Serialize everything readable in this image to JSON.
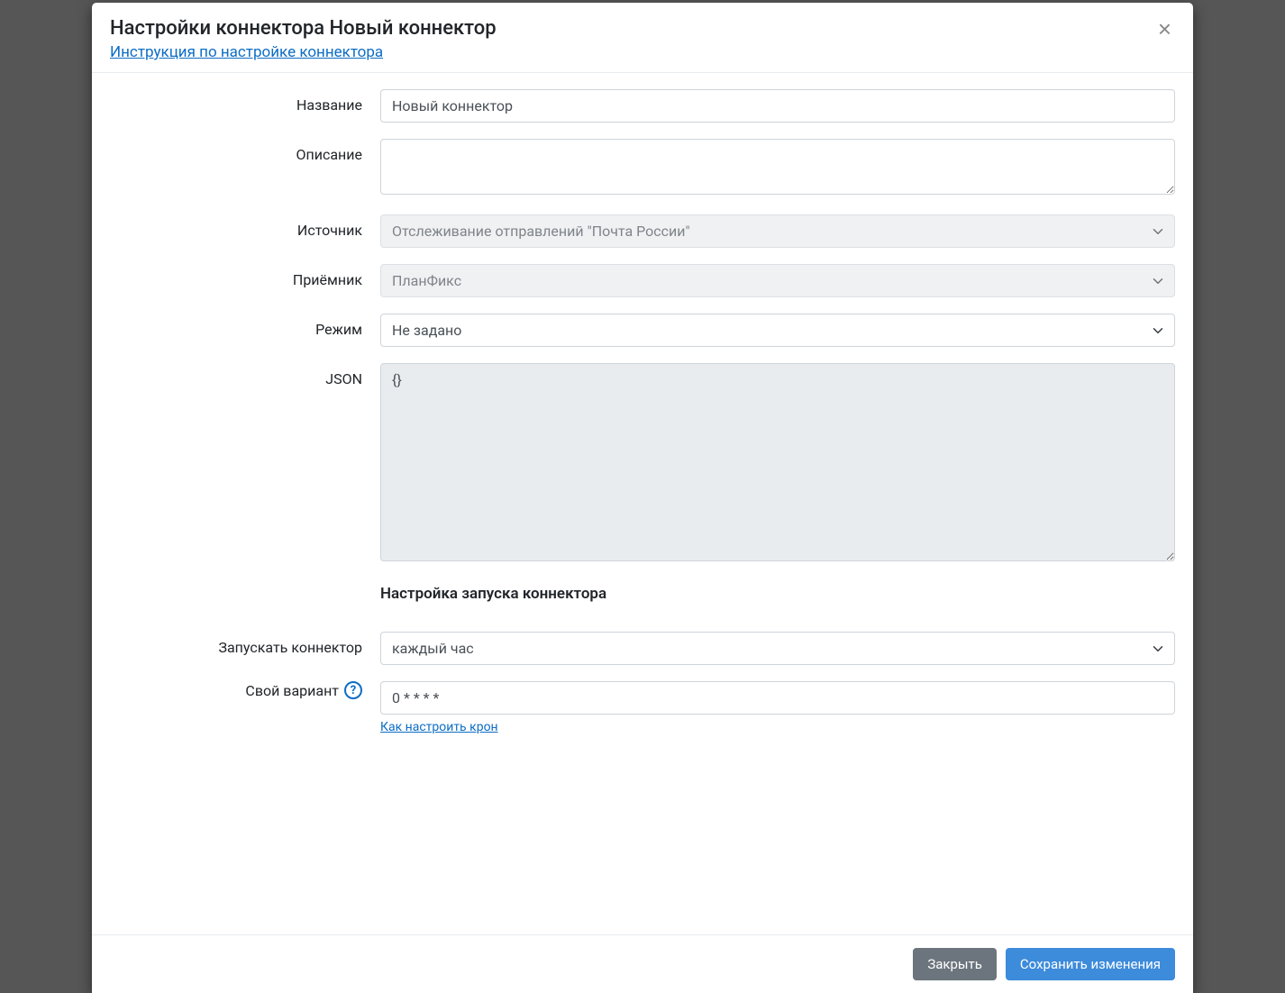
{
  "header": {
    "title": "Настройки коннектора Новый коннектор",
    "instructions_link": "Инструкция по настройке коннектора"
  },
  "form": {
    "name": {
      "label": "Название",
      "value": "Новый коннектор"
    },
    "description": {
      "label": "Описание",
      "value": ""
    },
    "source": {
      "label": "Источник",
      "value": "Отслеживание отправлений \"Почта России\""
    },
    "receiver": {
      "label": "Приёмник",
      "value": "ПланФикс"
    },
    "mode": {
      "label": "Режим",
      "value": "Не задано"
    },
    "json": {
      "label": "JSON",
      "value": "{}"
    },
    "schedule_section_title": "Настройка запуска коннектора",
    "run": {
      "label": "Запускать коннектор",
      "value": "каждый час"
    },
    "custom": {
      "label": "Свой вариант",
      "value": "0 * * * *",
      "help_link": "Как настроить крон"
    }
  },
  "footer": {
    "close": "Закрыть",
    "save": "Сохранить изменения"
  }
}
